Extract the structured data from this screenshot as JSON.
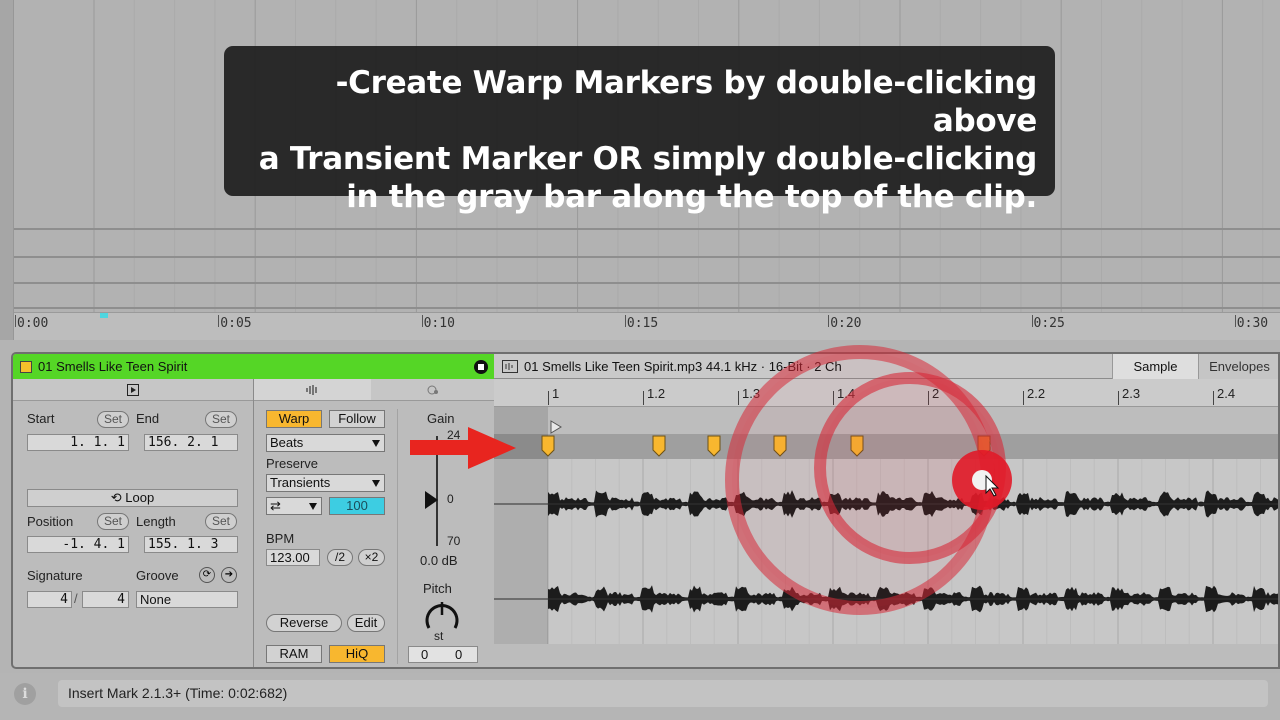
{
  "tooltip": {
    "line1": "-Create Warp Markers by double-clicking above",
    "line2": "a Transient Marker OR simply double-clicking",
    "line3": "in the gray bar along the top of the clip."
  },
  "arrangement_ruler": {
    "labels": [
      "0:00",
      "0:05",
      "0:10",
      "0:15",
      "0:20",
      "0:25",
      "0:30"
    ]
  },
  "clip": {
    "name": "01 Smells Like Teen Spirit",
    "color": "#55d626",
    "start_label": "Start",
    "start_set": "Set",
    "start_value": "1.  1.  1",
    "end_label": "End",
    "end_set": "Set",
    "end_value": "156.  2.  1",
    "loop_label": "Loop",
    "position_label": "Position",
    "position_set": "Set",
    "position_value": "-1.  4.  1",
    "length_label": "Length",
    "length_set": "Set",
    "length_value": "155.  1.  3",
    "signature_label": "Signature",
    "signature_num": "4",
    "signature_den": "4",
    "groove_label": "Groove",
    "groove_value": "None"
  },
  "warp": {
    "warp_label": "Warp",
    "follow_label": "Follow",
    "mode": "Beats",
    "preserve_label": "Preserve",
    "preserve_value": "Transients",
    "loop_mode_value": "100",
    "bpm_label": "BPM",
    "bpm_value": "123.00",
    "half_label": "/2",
    "double_label": "×2",
    "reverse_label": "Reverse",
    "edit_label": "Edit",
    "ram_label": "RAM",
    "hiq_label": "HiQ"
  },
  "gain": {
    "label": "Gain",
    "top": "24",
    "zero": "0",
    "bottom": "70",
    "value": "0.0 dB",
    "pitch_label": "Pitch",
    "pitch_unit": "st",
    "transpose": "0",
    "detune": "0"
  },
  "sample": {
    "file_info": "01 Smells Like Teen Spirit.mp3   44.1 kHz · 16-Bit · 2 Ch",
    "tab_sample": "Sample",
    "tab_envelopes": "Envelopes",
    "beat_labels": [
      "1",
      "1.2",
      "1.3",
      "1.4",
      "2",
      "2.2",
      "2.3",
      "2.4"
    ]
  },
  "status": {
    "message": "Insert Mark 2.1.3+ (Time: 0:02:682)"
  },
  "colors": {
    "accent_orange": "#f8b72f",
    "clip_green": "#55d626",
    "cyan": "#3dcde2",
    "arrow_red": "#e8251f"
  }
}
